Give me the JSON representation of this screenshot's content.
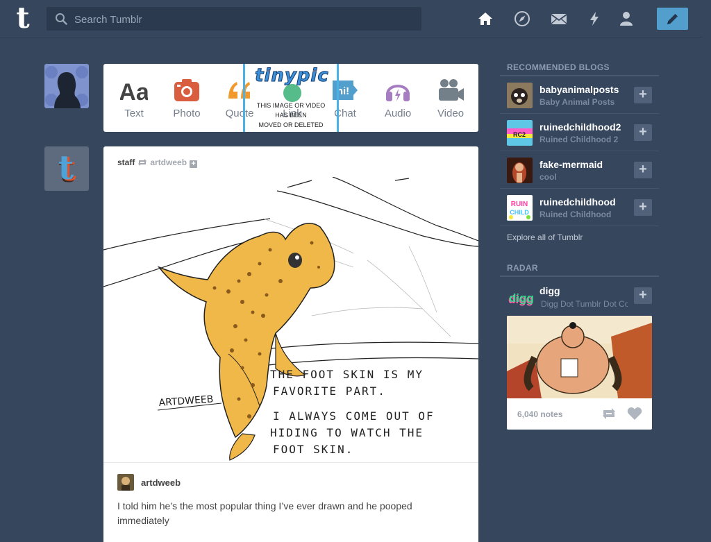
{
  "header": {
    "logo": "t",
    "search_placeholder": "Search Tumblr",
    "nav_icons": [
      "home-icon",
      "explore-compass-icon",
      "inbox-mail-icon",
      "activity-lightning-icon",
      "account-person-icon"
    ],
    "compose_icon": "pencil-icon",
    "accent_color": "#529ecc"
  },
  "composer": {
    "post_types": [
      {
        "label": "Text",
        "icon": "text-aa-icon",
        "color": "#444444"
      },
      {
        "label": "Photo",
        "icon": "camera-icon",
        "color": "#d95e40"
      },
      {
        "label": "Quote",
        "icon": "quote-icon",
        "color": "#f2992e"
      },
      {
        "label": "Link",
        "icon": "link-icon",
        "color": "#56bc8a"
      },
      {
        "label": "Chat",
        "icon": "chat-hi-icon",
        "color": "#529ecc"
      },
      {
        "label": "Audio",
        "icon": "headphones-icon",
        "color": "#a77dc2"
      },
      {
        "label": "Video",
        "icon": "video-camera-icon",
        "color": "#748089"
      }
    ],
    "overlay": {
      "logo_text": "tinypic",
      "message_lines": [
        "THIS IMAGE OR VIDEO",
        "HAS BEEN",
        "MOVED OR DELETED"
      ]
    }
  },
  "post": {
    "author": "staff",
    "reblogged_from": "artdweeb",
    "follow_symbol": "+",
    "artwork": {
      "signature": "ARTDWEEB",
      "handwriting_lines": [
        "THE FOOT SKIN IS MY",
        "FAVORITE PART.",
        "I ALWAYS COME OUT OF",
        "HIDING TO WATCH THE",
        "FOOT SKIN."
      ]
    },
    "caption_user": "artdweeb",
    "caption_text": "I told him he’s the most popular thing I’ve ever drawn and he pooped immediately"
  },
  "sidebar": {
    "recommended_heading": "Recommended Blogs",
    "recommended": [
      {
        "name": "babyanimalposts",
        "desc": "Baby Animal Posts"
      },
      {
        "name": "ruinedchildhood2",
        "desc": "Ruined Childhood 2"
      },
      {
        "name": "fake-mermaid",
        "desc": "cool"
      },
      {
        "name": "ruinedchildhood",
        "desc": "Ruined Childhood"
      }
    ],
    "follow_symbol": "+",
    "explore_link": "Explore all of Tumblr",
    "radar_heading": "Radar",
    "radar": {
      "name": "digg",
      "desc": "Digg Dot Tumblr Dot Com",
      "avatar_text": "digg",
      "notes": "6,040 notes"
    }
  }
}
